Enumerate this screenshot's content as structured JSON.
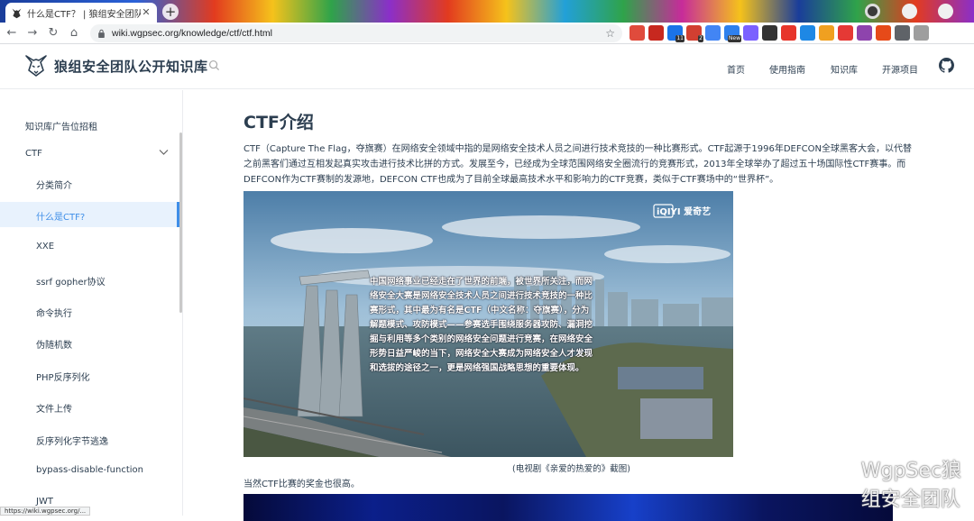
{
  "browser": {
    "tab_title": "什么是CTF？ | 狼组安全团队公开知",
    "url": "wiki.wgpsec.org/knowledge/ctf/ctf.html",
    "status_url": "https://wiki.wgpsec.org/...",
    "extensions": [
      {
        "name": "adblock-icon",
        "color": "#e04b3c",
        "badge": ""
      },
      {
        "name": "abp-icon",
        "color": "#c7281f",
        "badge": ""
      },
      {
        "name": "calendar-icon",
        "color": "#1a73e8",
        "badge": "11"
      },
      {
        "name": "grammar-icon",
        "color": "#d23f31",
        "badge": "2"
      },
      {
        "name": "translate-icon",
        "color": "#4285f4",
        "badge": ""
      },
      {
        "name": "new-ext-icon",
        "color": "#2f80ed",
        "badge": "New"
      },
      {
        "name": "mail-icon",
        "color": "#7b61ff",
        "badge": ""
      },
      {
        "name": "puzzle-dark-icon",
        "color": "#333333",
        "badge": ""
      },
      {
        "name": "s-ext-icon",
        "color": "#e7352b",
        "badge": ""
      },
      {
        "name": "bookmark-icon",
        "color": "#1e88e5",
        "badge": ""
      },
      {
        "name": "cookie-icon",
        "color": "#f0a020",
        "badge": ""
      },
      {
        "name": "yz-icon",
        "color": "#e53935",
        "badge": ""
      },
      {
        "name": "ip-icon",
        "color": "#8e44ad",
        "badge": ""
      },
      {
        "name": "note-icon",
        "color": "#e64a19",
        "badge": ""
      },
      {
        "name": "extensions-icon",
        "color": "#5f6368",
        "badge": ""
      },
      {
        "name": "profile-icon",
        "color": "#9e9e9e",
        "badge": ""
      }
    ]
  },
  "site": {
    "title": "狼组安全团队公开知识库",
    "nav": {
      "home": "首页",
      "guide": "使用指南",
      "knowledge": "知识库",
      "projects": "开源项目"
    }
  },
  "sidebar": {
    "ad": "知识库广告位招租",
    "group": "CTF",
    "items": [
      "分类简介",
      "什么是CTF?",
      "XXE",
      "ssrf gopher协议",
      "命令执行",
      "伪随机数",
      "PHP反序列化",
      "文件上传",
      "反序列化字节逃逸",
      "bypass-disable-function",
      "JWT"
    ],
    "active_index": 1
  },
  "main": {
    "title": "CTF介绍",
    "paragraph": "CTF（Capture The Flag，夺旗赛）在网络安全领域中指的是网络安全技术人员之间进行技术竞技的一种比赛形式。CTF起源于1996年DEFCON全球黑客大会，以代替之前黑客们通过互相发起真实攻击进行技术比拼的方式。发展至今，已经成为全球范围网络安全圈流行的竞赛形式，2013年全球举办了超过五十场国际性CTF赛事。而DEFCON作为CTF赛制的发源地，DEFCON CTF也成为了目前全球最高技术水平和影响力的CTF竞赛，类似于CTF赛场中的“世界杯”。",
    "video_text": "中国网络事业已经走在了世界的前端，被世界所关注，而网络安全大赛是网络安全技术人员之间进行技术竞技的一种比赛形式，其中最为有名是CTF（中文名称：夺旗赛），分为解题模式、攻防模式——参赛选手围绕服务器攻防、漏洞挖掘与利用等多个类别的网络安全问题进行竞赛，在网络安全形势日益严峻的当下，网络安全大赛成为网络安全人才发现和选拔的途径之一，更是网络强国战略思想的重要体现。",
    "video_logo": "iQIYI 爱奇艺",
    "caption": "(电视剧《亲爱的热爱的》截图)",
    "paragraph2": "当然CTF比赛的奖金也很高。",
    "watermark": "WgpSec狼组安全团队"
  }
}
